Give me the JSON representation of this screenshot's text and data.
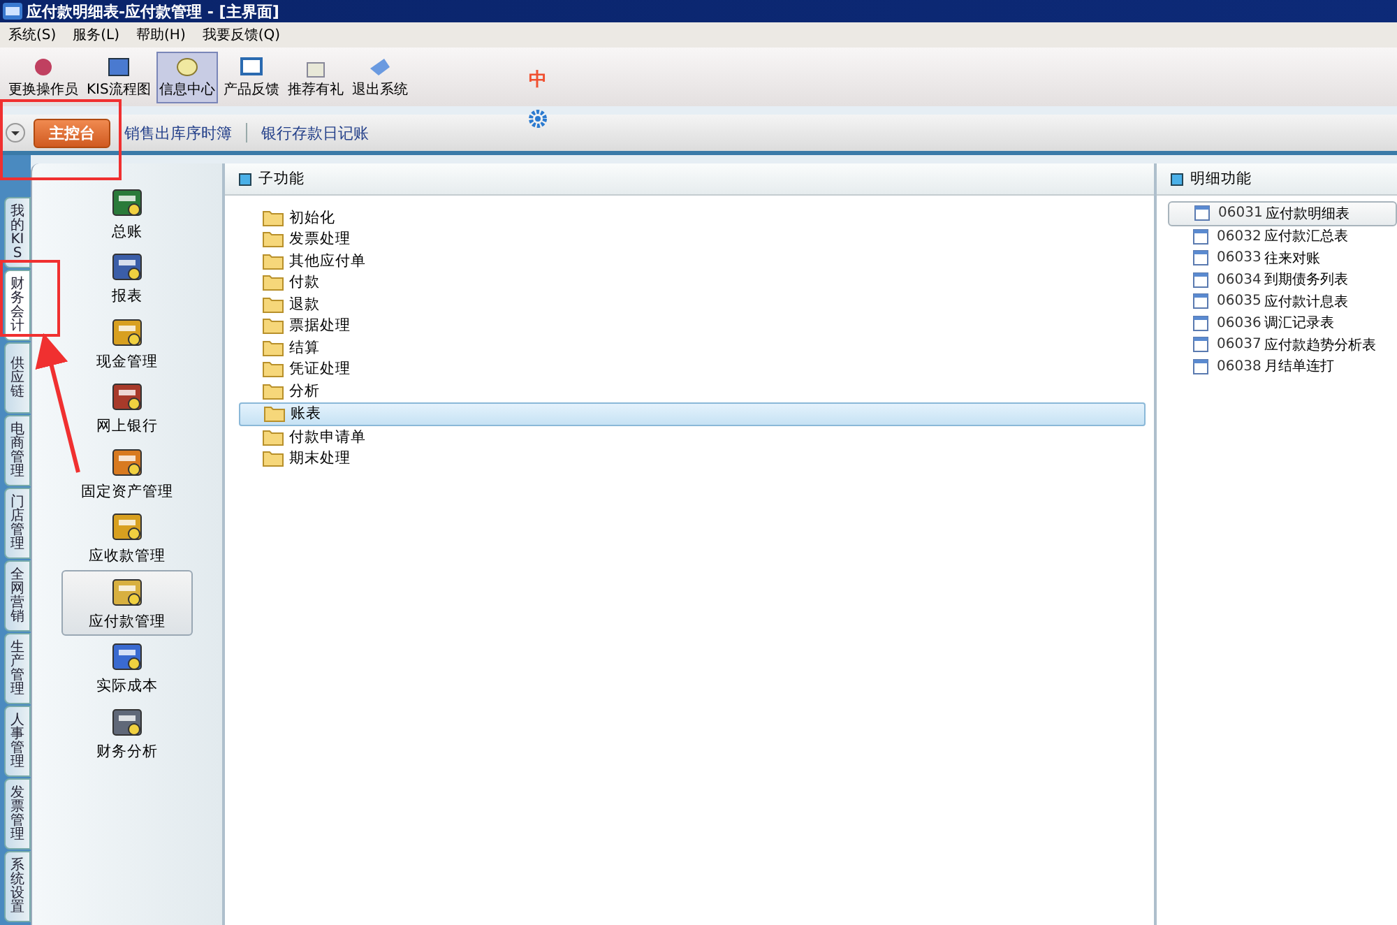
{
  "window": {
    "title": "应付款明细表-应付款管理 - [主界面]"
  },
  "menu": [
    "系统(S)",
    "服务(L)",
    "帮助(H)",
    "我要反馈(Q)"
  ],
  "toolbar": [
    {
      "label": "更换操作员",
      "selected": false
    },
    {
      "label": "KIS流程图",
      "selected": false
    },
    {
      "label": "信息中心",
      "selected": true
    },
    {
      "label": "产品反馈",
      "selected": false
    },
    {
      "label": "推荐有礼",
      "selected": false
    },
    {
      "label": "退出系统",
      "selected": false
    }
  ],
  "ime": {
    "label": "中"
  },
  "tabs": [
    {
      "label": "主控台",
      "selected": true
    },
    {
      "label": "销售出库序时簿",
      "selected": false
    },
    {
      "label": "银行存款日记账",
      "selected": false
    }
  ],
  "side_tabs": [
    {
      "label": "我的KIS",
      "selected": false
    },
    {
      "label": "财务会计",
      "selected": true
    },
    {
      "label": "供应链",
      "selected": false
    },
    {
      "label": "电商管理",
      "selected": false
    },
    {
      "label": "门店管理",
      "selected": false
    },
    {
      "label": "全网营销",
      "selected": false
    },
    {
      "label": "生产管理",
      "selected": false
    },
    {
      "label": "人事管理",
      "selected": false
    },
    {
      "label": "发票管理",
      "selected": false
    },
    {
      "label": "系统设置",
      "selected": false
    }
  ],
  "modules": [
    {
      "label": "总账",
      "selected": false
    },
    {
      "label": "报表",
      "selected": false
    },
    {
      "label": "现金管理",
      "selected": false
    },
    {
      "label": "网上银行",
      "selected": false
    },
    {
      "label": "固定资产管理",
      "selected": false
    },
    {
      "label": "应收款管理",
      "selected": false
    },
    {
      "label": "应付款管理",
      "selected": true
    },
    {
      "label": "实际成本",
      "selected": false
    },
    {
      "label": "财务分析",
      "selected": false
    }
  ],
  "sub_functions": {
    "title": "子功能",
    "items": [
      {
        "label": "初始化",
        "selected": false
      },
      {
        "label": "发票处理",
        "selected": false
      },
      {
        "label": "其他应付单",
        "selected": false
      },
      {
        "label": "付款",
        "selected": false
      },
      {
        "label": "退款",
        "selected": false
      },
      {
        "label": "票据处理",
        "selected": false
      },
      {
        "label": "结算",
        "selected": false
      },
      {
        "label": "凭证处理",
        "selected": false
      },
      {
        "label": "分析",
        "selected": false
      },
      {
        "label": "账表",
        "selected": true
      },
      {
        "label": "付款申请单",
        "selected": false
      },
      {
        "label": "期末处理",
        "selected": false
      }
    ]
  },
  "detail_functions": {
    "title": "明细功能",
    "items": [
      {
        "code": "06031",
        "label": "应付款明细表",
        "selected": true
      },
      {
        "code": "06032",
        "label": "应付款汇总表",
        "selected": false
      },
      {
        "code": "06033",
        "label": "往来对账",
        "selected": false
      },
      {
        "code": "06034",
        "label": "到期债务列表",
        "selected": false
      },
      {
        "code": "06035",
        "label": "应付款计息表",
        "selected": false
      },
      {
        "code": "06036",
        "label": "调汇记录表",
        "selected": false
      },
      {
        "code": "06037",
        "label": "应付款趋势分析表",
        "selected": false
      },
      {
        "code": "06038",
        "label": "月结单连打",
        "selected": false
      }
    ]
  }
}
